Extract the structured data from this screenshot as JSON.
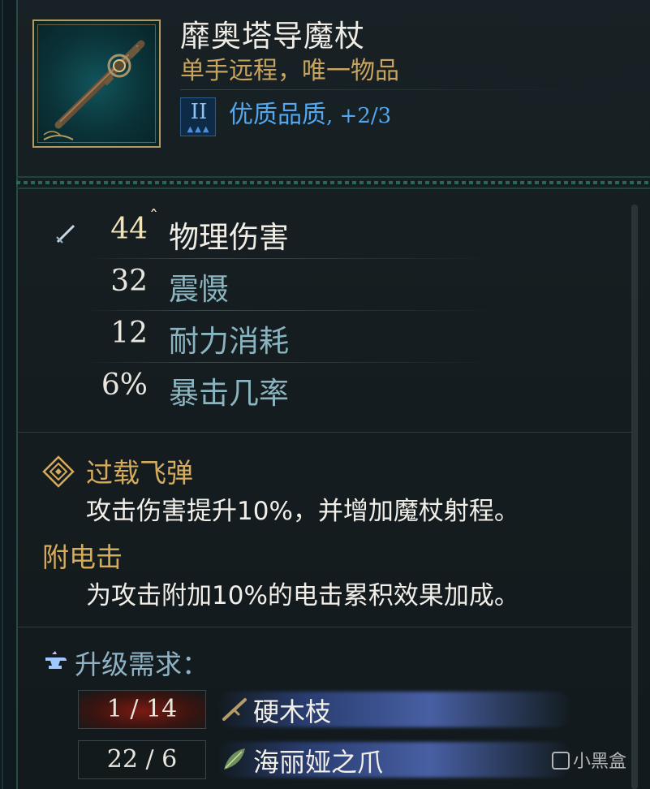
{
  "item": {
    "name": "靡奥塔导魔杖",
    "subtitle": "单手远程，唯一物品",
    "tier_roman": "II",
    "quality_label": "优质品质",
    "quality_upgrade": ", +2/3",
    "quality_color": "#52a7ef",
    "image": "wand-image"
  },
  "stats": [
    {
      "value": "44",
      "label": "物理伤害",
      "primary": true,
      "icon": "sword-icon",
      "caret": "ˆ"
    },
    {
      "value": "32",
      "label": "震慑"
    },
    {
      "value": "12",
      "label": "耐力消耗"
    },
    {
      "value": "6%",
      "label": "暴击几率"
    }
  ],
  "effects": [
    {
      "title": "过载飞弹",
      "desc": "攻击伤害提升10%，并增加魔杖射程。",
      "icon": "diamond-rune-icon"
    },
    {
      "title": "附电击",
      "desc": "为攻击附加10%的电击累积效果加成。"
    }
  ],
  "upgrade": {
    "title": "升级需求：",
    "icon": "anvil-icon",
    "requirements": [
      {
        "count": "1 / 14",
        "name": "硬木枝",
        "insufficient": true,
        "icon": "branch-icon"
      },
      {
        "count": "22 / 6",
        "name": "海丽娅之爪",
        "insufficient": false,
        "icon": "leaf-icon"
      }
    ]
  },
  "watermark": "小黑盒",
  "colors": {
    "gold": "#d6ab5c",
    "stat_label": "#8ab5c0",
    "accent_blue": "#52a7ef"
  }
}
